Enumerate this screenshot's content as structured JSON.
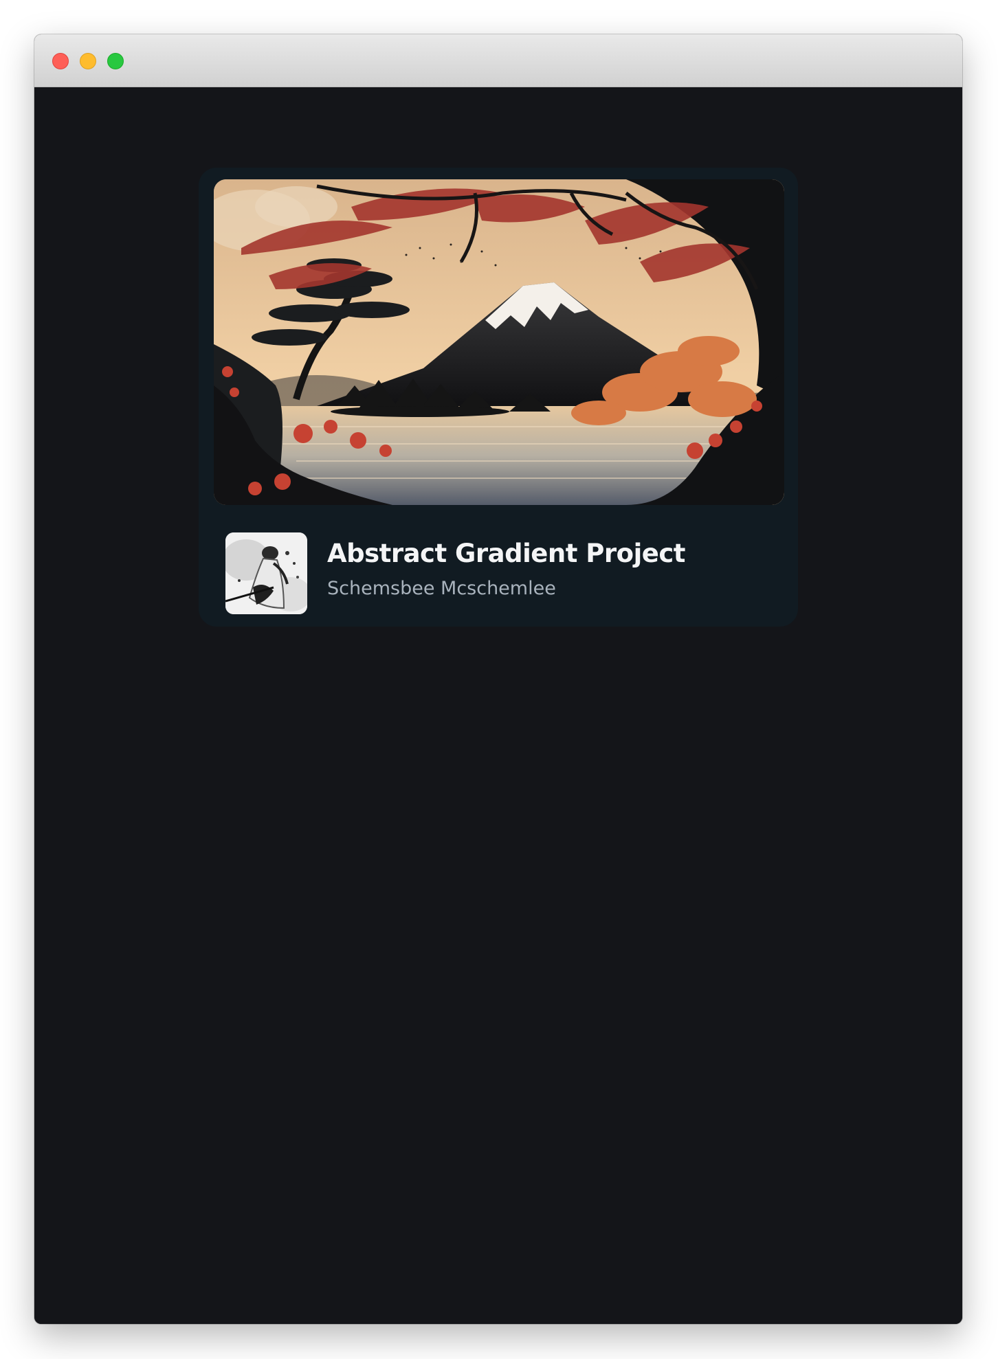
{
  "window": {
    "controls": [
      "close",
      "minimize",
      "maximize"
    ]
  },
  "card": {
    "title": "Abstract Gradient Project",
    "author": "Schemsbee Mcschemlee",
    "cover_image": "ukiyo-e-mountain-lake-illustration",
    "avatar_image": "ink-samurai-portrait"
  },
  "colors": {
    "background": "#141519",
    "card_background": "#111b22",
    "title_text": "#f4f5f6",
    "author_text": "#a9b3bd",
    "traffic_close": "#fe5f57",
    "traffic_minimize": "#febc2e",
    "traffic_maximize": "#28c840"
  }
}
